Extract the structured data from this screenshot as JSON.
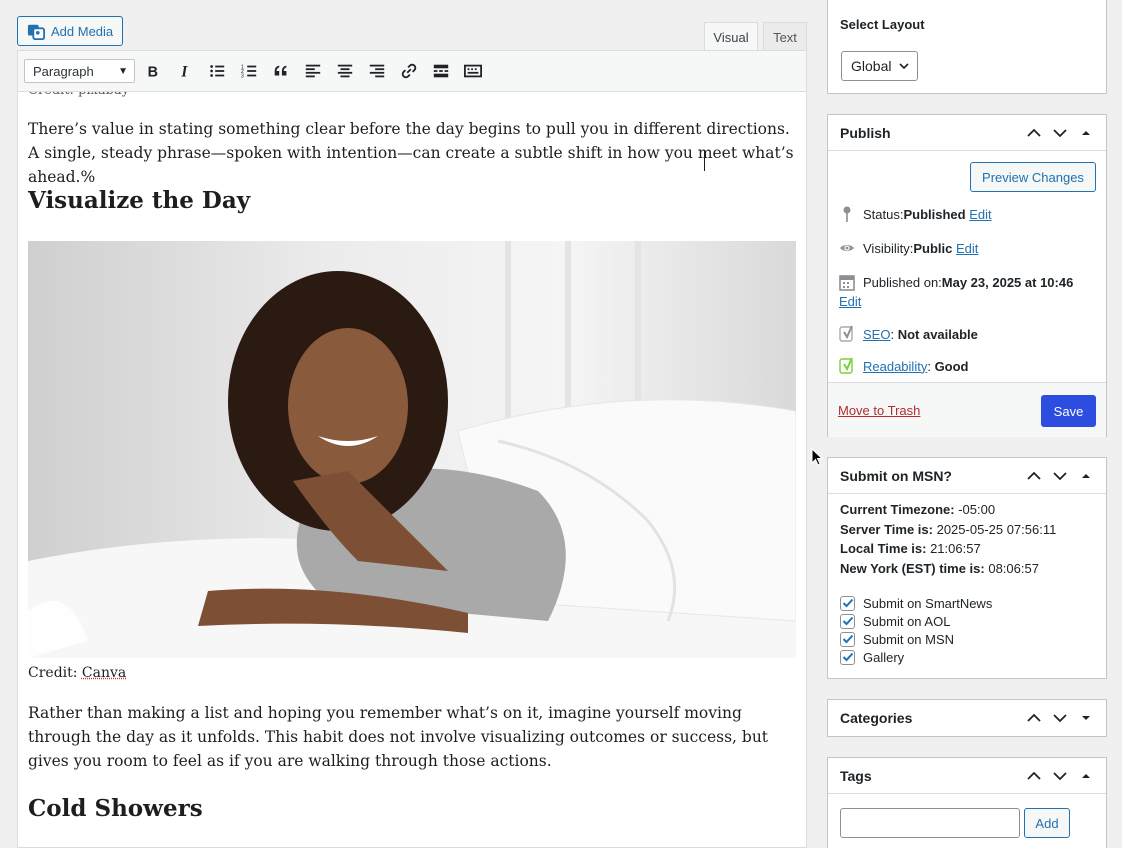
{
  "editor": {
    "add_media": "Add Media",
    "tabs": {
      "visual": "Visual",
      "text": "Text"
    },
    "format_select": "Paragraph",
    "credit_top": "Credit: pixabay",
    "paragraph1": "There’s value in stating something clear before the day begins to pull you in different directions. A single, steady phrase—spoken with intention—can create a subtle shift in how you meet what’s ahead.%",
    "heading1": "Visualize the Day",
    "credit_label": "Credit: ",
    "credit_link": "Canva",
    "paragraph2": "Rather than making a list and hoping you remember what’s on it, imagine yourself moving through the day as it unfolds. This habit does not involve visualizing outcomes or success, but gives you room to feel as if you are walking through those actions.",
    "heading2": "Cold Showers"
  },
  "sidebar": {
    "layout": {
      "title": "Select Layout",
      "value": "Global"
    },
    "publish": {
      "title": "Publish",
      "preview_button": "Preview Changes",
      "status_label": "Status: ",
      "status_value": "Published",
      "visibility_label": "Visibility: ",
      "visibility_value": "Public",
      "published_label": "Published on: ",
      "published_value": "May 23, 2025 at 10:46",
      "edit": "Edit",
      "seo_link": "SEO",
      "seo_value": "Not available",
      "readability_link": "Readability",
      "readability_value": "Good",
      "trash": "Move to Trash",
      "save": "Save"
    },
    "msn": {
      "title": "Submit on MSN?",
      "tz_label": "Current Timezone:",
      "tz_value": " -05:00",
      "server_label": "Server Time is:",
      "server_value": " 2025-05-25 07:56:11",
      "local_label": "Local Time is:",
      "local_value": " 21:06:57",
      "ny_label": "New York (EST) time is:",
      "ny_value": " 08:06:57",
      "checkboxes": [
        {
          "label": "Submit on SmartNews",
          "checked": true
        },
        {
          "label": "Submit on AOL",
          "checked": true
        },
        {
          "label": "Submit on MSN",
          "checked": true
        },
        {
          "label": "Gallery",
          "checked": true
        }
      ]
    },
    "categories": {
      "title": "Categories"
    },
    "tags": {
      "title": "Tags",
      "add_button": "Add",
      "input_value": ""
    }
  },
  "colors": {
    "accent": "#2271b1",
    "primary_button": "#2d4de0",
    "yoast_green": "#7ad03a",
    "trash_red": "#b32d2e"
  }
}
